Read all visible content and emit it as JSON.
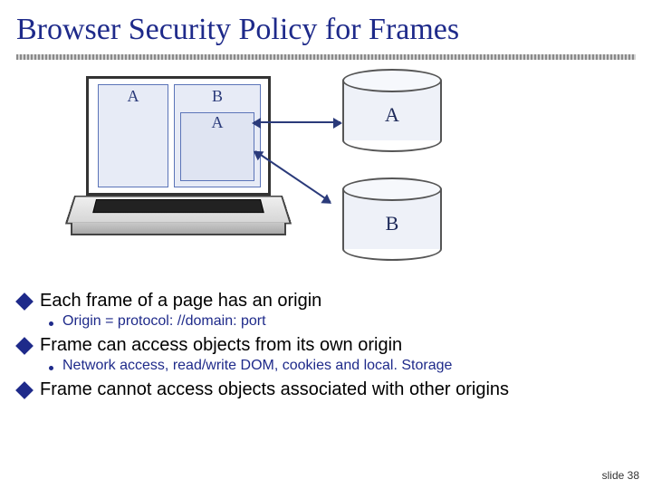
{
  "title": "Browser Security Policy for Frames",
  "diagram": {
    "frame_a": "A",
    "frame_b": "B",
    "frame_b_inner": "A",
    "cylinder_a": "A",
    "cylinder_b": "B"
  },
  "bullets": {
    "b1": "Each frame of a page has an origin",
    "b1a": "Origin = protocol: //domain: port",
    "b2": "Frame can access objects from its own origin",
    "b2a": "Network access, read/write DOM, cookies and local. Storage",
    "b3": "Frame cannot access objects associated with other origins"
  },
  "footer": "slide 38"
}
